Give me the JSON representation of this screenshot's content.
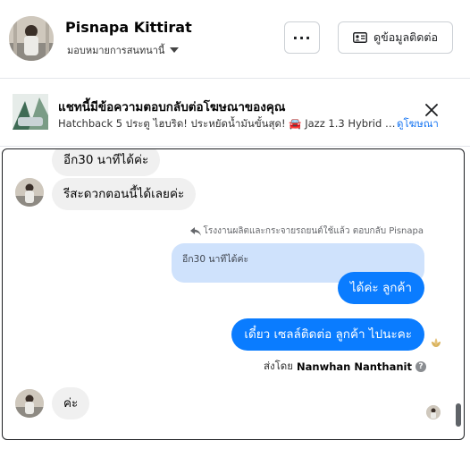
{
  "header": {
    "name": "Pisnapa Kittirat",
    "assign_label": "มอบหมายการสนทนานี้",
    "more_label": "···",
    "contact_label": "ดูข้อมูลติดต่อ"
  },
  "ad": {
    "title": "แชทนี้มีข้อความตอบกลับต่อโฆษณาของคุณ",
    "text": "Hatchback 5 ประตู ไฮบริด! ประหยัดน้ำมันขั้นสุด! 🚘 Jazz 1.3 Hybrid AT...",
    "link_label": "ดูโฆษณา"
  },
  "chat": {
    "msg_partial": "อีก30 นาทีได้ค่ะ",
    "msg_in_1": "รีสะดวกตอนนี้ได้เลยค่ะ",
    "reply_note": "โรงงานผลิตและกระจายรถยนต์ใช้แล้ว ตอบกลับ Pisnapa",
    "quoted_text": "อีก30 นาทีได้ค่ะ",
    "msg_out_1": "ได้ค่ะ  ลูกค้า",
    "msg_out_2": "เดี๋ยว เซลล์ติดต่อ ลูกค้า  ไปนะคะ",
    "sent_by_prefix": "ส่งโดย",
    "sent_by_name": "Nanwhan Nanthanit",
    "msg_in_2": "ค่ะ"
  },
  "colors": {
    "accent": "#0a7cff",
    "quoted_bg": "#cfe2fc",
    "incoming_bg": "#f0f0f0"
  }
}
